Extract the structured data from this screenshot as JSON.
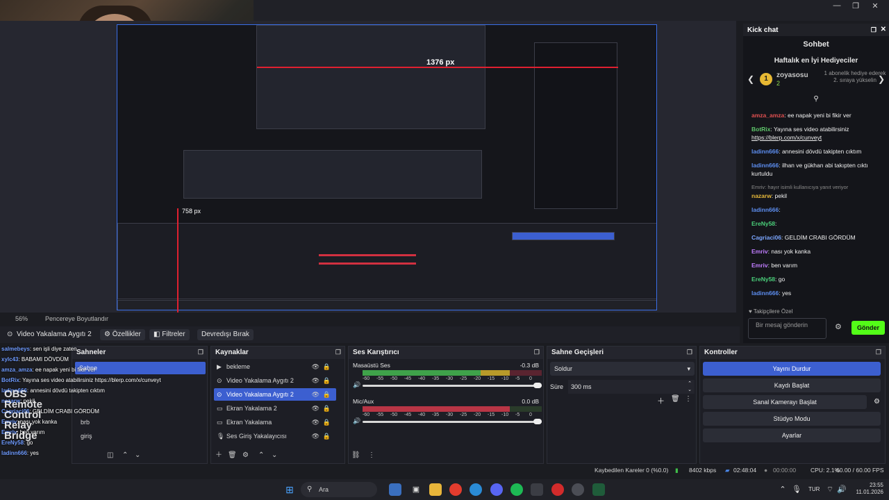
{
  "preview": {
    "dim_h": "1376 px",
    "dim_v": "758 px",
    "zoom": "56%",
    "fit_label": "Pencereye Boyutlandır"
  },
  "chat": {
    "header": "Kick chat",
    "title": "Sohbet",
    "subtitle": "Haftalık en İyi Hediyeciler",
    "gift": {
      "rank": "1",
      "user": "zoyasosu",
      "count": "2",
      "desc": "1 abonelik hediye ederek 2. sıraya yükselin"
    },
    "messages": [
      {
        "user": "amza_amza",
        "text": ": ee napak yeni bi fikir ver",
        "color": "#e05050"
      },
      {
        "user": "BotRix",
        "text": ": Yayına ses video atabilirsiniz",
        "link": "https://blerp.com/x/cunveyt",
        "color": "#5fc66b"
      },
      {
        "user": "ladinn666",
        "text": ": annesini dövdü takipten cıktım",
        "color": "#5d8ef0"
      },
      {
        "user": "ladinn666",
        "text": ": ilhan ve gükhan abi takıpten cıktı kurtuldu",
        "color": "#5d8ef0"
      },
      {
        "user": "nazarw",
        "text": ": pekil",
        "color": "#e6b83a",
        "reply": "Emriv: hayır isimli kullanıcıya yanıt veriyor"
      },
      {
        "user": "ladinn666",
        "text": ":",
        "color": "#5d8ef0"
      },
      {
        "user": "EreNy58",
        "text": ":",
        "color": "#4ad07a"
      },
      {
        "user": "Cagriaci06",
        "text": ": GELDİM CRABI GÖRDÜM",
        "color": "#7ba6ff"
      },
      {
        "user": "Emriv",
        "text": ": nası yok kanka",
        "color": "#c07dff"
      },
      {
        "user": "Emriv",
        "text": ": ben varım",
        "color": "#c07dff"
      },
      {
        "user": "EreNy58",
        "text": ": go",
        "color": "#4ad07a"
      },
      {
        "user": "ladinn666",
        "text": ": yes",
        "color": "#5d8ef0"
      }
    ],
    "followers": "Takipçilere Özel",
    "input_placeholder": "Bir mesaj gönderin",
    "send": "Gönder"
  },
  "toolbar": {
    "source": "Video Yakalama Aygıtı 2",
    "properties": "Özellikler",
    "filters": "Filtreler",
    "deactivate": "Devredışı Bırak"
  },
  "scenes": {
    "title": "Sahneler",
    "items": [
      "Sahne",
      "brb",
      "giriş"
    ]
  },
  "sources": {
    "title": "Kaynaklar",
    "items": [
      {
        "label": "bekleme",
        "icon": "▶"
      },
      {
        "label": "Video Yakalama Aygıtı 2",
        "icon": "⊙"
      },
      {
        "label": "Video Yakalama Aygıtı 2",
        "icon": "⊙"
      },
      {
        "label": "Ekran Yakalama 2",
        "icon": "▭"
      },
      {
        "label": "Ekran Yakalama",
        "icon": "▭"
      },
      {
        "label": "Ses Giriş Yakalayıcısı",
        "icon": "🎙"
      }
    ]
  },
  "mixer": {
    "title": "Ses Karıştırıcı",
    "channels": [
      {
        "name": "Masaüstü Ses",
        "db": "-0.3 dB"
      },
      {
        "name": "Mic/Aux",
        "db": "0.0 dB"
      }
    ],
    "scale": [
      "-60",
      "-55",
      "-50",
      "-45",
      "-40",
      "-35",
      "-30",
      "-25",
      "-20",
      "-15",
      "-10",
      "-5",
      "0"
    ]
  },
  "transitions": {
    "title": "Sahne Geçişleri",
    "type": "Soldur",
    "duration_label": "Süre",
    "duration": "300 ms"
  },
  "controls": {
    "title": "Kontroller",
    "stop_stream": "Yayını Durdur",
    "start_record": "Kaydı Başlat",
    "virtual_cam": "Sanal Kamerayı Başlat",
    "studio": "Stüdyo Modu",
    "settings": "Ayarlar"
  },
  "overlay_chat": [
    {
      "user": "salmebeys",
      "text": ": sen işli diye zaten"
    },
    {
      "user": "xylc43",
      "text": ": BABAMI DÖVDÜM"
    },
    {
      "user": "amza_amza",
      "text": ": ee napak yeni bi fikir ver"
    },
    {
      "user": "BotRix",
      "text": ": Yayına ses video atabilirsiniz https://blerp.com/x/cunveyt"
    },
    {
      "user": "ladinn666",
      "text": ": annesini dövdü takipten cıktım"
    },
    {
      "user": "nazarw",
      "text": ": pekil"
    },
    {
      "user": "Cagriaci06",
      "text": ": GELDİM CRABI GÖRDÜM"
    },
    {
      "user": "Emriv",
      "text": ": nası yok kanka"
    },
    {
      "user": "Emriv",
      "text": ": ben varım"
    },
    {
      "user": "EreNy58",
      "text": ": go"
    },
    {
      "user": "ladinn666",
      "text": ": yes"
    }
  ],
  "overlay_badge": [
    "OBS",
    "Remote",
    "Control",
    "Relay",
    "Bridge"
  ],
  "status": {
    "dropped": "Kaybedilen Kareler 0 (%0.0)",
    "bitrate": "8402 kbps",
    "live_time": "02:48:04",
    "rec_time": "00:00:00",
    "cpu": "CPU: 2.1%",
    "fps": "60.00 / 60.00 FPS"
  },
  "taskbar": {
    "search": "Ara",
    "lang": "TUR",
    "time": "23:55",
    "date": "11.01.2026"
  }
}
